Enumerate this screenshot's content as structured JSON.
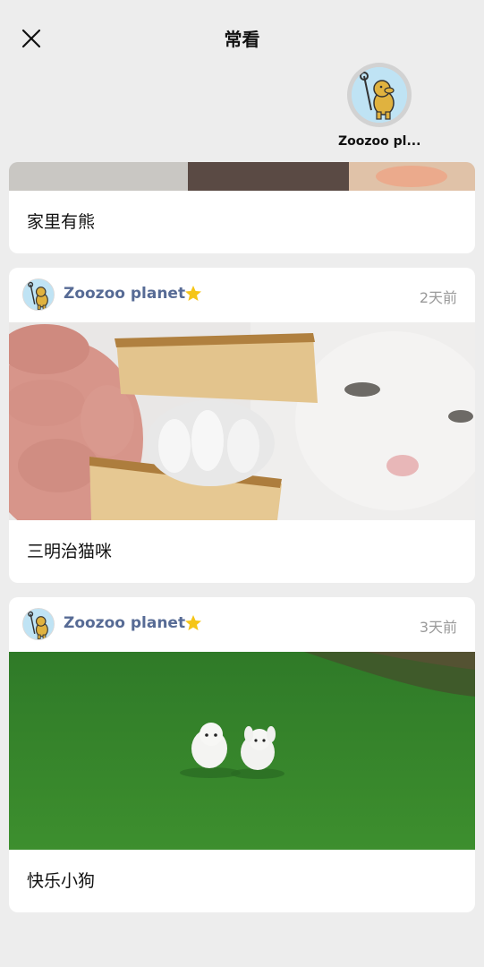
{
  "header": {
    "title": "常看",
    "close_icon": "close-icon"
  },
  "pinned_account": {
    "name": "Zoozoo pl..."
  },
  "cards": [
    {
      "caption": "家里有熊"
    },
    {
      "author": "Zoozoo planet",
      "time": "2天前",
      "caption": "三明治猫咪",
      "image": "cat-paw-in-bread-photo"
    },
    {
      "author": "Zoozoo planet",
      "time": "3天前",
      "caption": "快乐小狗",
      "image": "puppies-running-on-grass-photo"
    }
  ],
  "colors": {
    "background": "#ededed",
    "author_link": "#576b95",
    "star": "#f5c518",
    "time": "#9a9a9a"
  }
}
